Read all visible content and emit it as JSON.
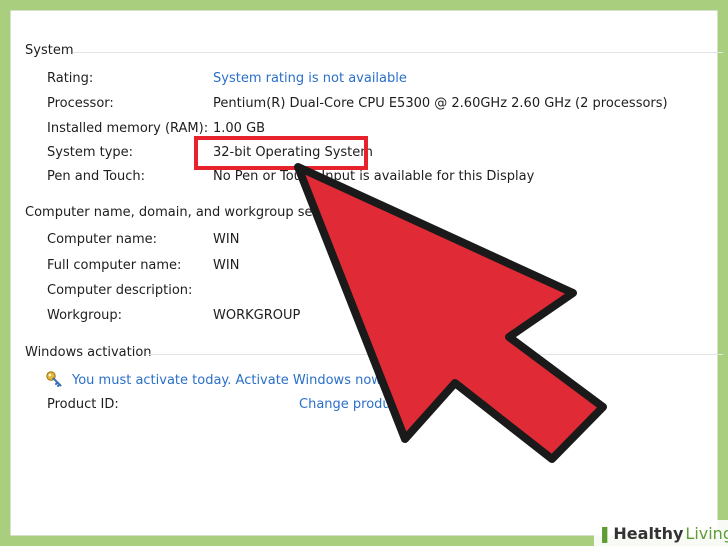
{
  "system": {
    "title": "System",
    "rows": [
      {
        "label": "Rating:",
        "value": "System rating is not available"
      },
      {
        "label": "Processor:",
        "value": "Pentium(R) Dual-Core  CPU     E5300  @ 2.60GHz   2.60 GHz  (2 processors)"
      },
      {
        "label": "Installed memory (RAM):",
        "value": "1.00 GB"
      },
      {
        "label": "System type:",
        "value": "32-bit Operating System"
      },
      {
        "label": "Pen and Touch:",
        "value": "No Pen or Touch Input is available for this Display"
      }
    ]
  },
  "computer": {
    "title": "Computer name, domain, and workgroup setting",
    "rows": [
      {
        "label": "Computer name:",
        "value": "WIN"
      },
      {
        "label": "Full computer name:",
        "value": "WIN"
      },
      {
        "label": "Computer description:",
        "value": ""
      },
      {
        "label": "Workgroup:",
        "value": "WORKGROUP"
      }
    ]
  },
  "activation": {
    "title": "Windows activation",
    "message": "You must activate today.  Activate Windows now",
    "product_id_label": "Product ID:",
    "change_link": "Change produc"
  },
  "watermark": {
    "brand_bold": "Healthy",
    "brand_light": "Living"
  },
  "colors": {
    "link": "#2a6fc9",
    "highlight": "#e8222d",
    "arrow": "#e02b36",
    "background": "#a9cf7e"
  },
  "icons": {
    "activation": "key-icon",
    "overlay": "arrow-pointer"
  }
}
